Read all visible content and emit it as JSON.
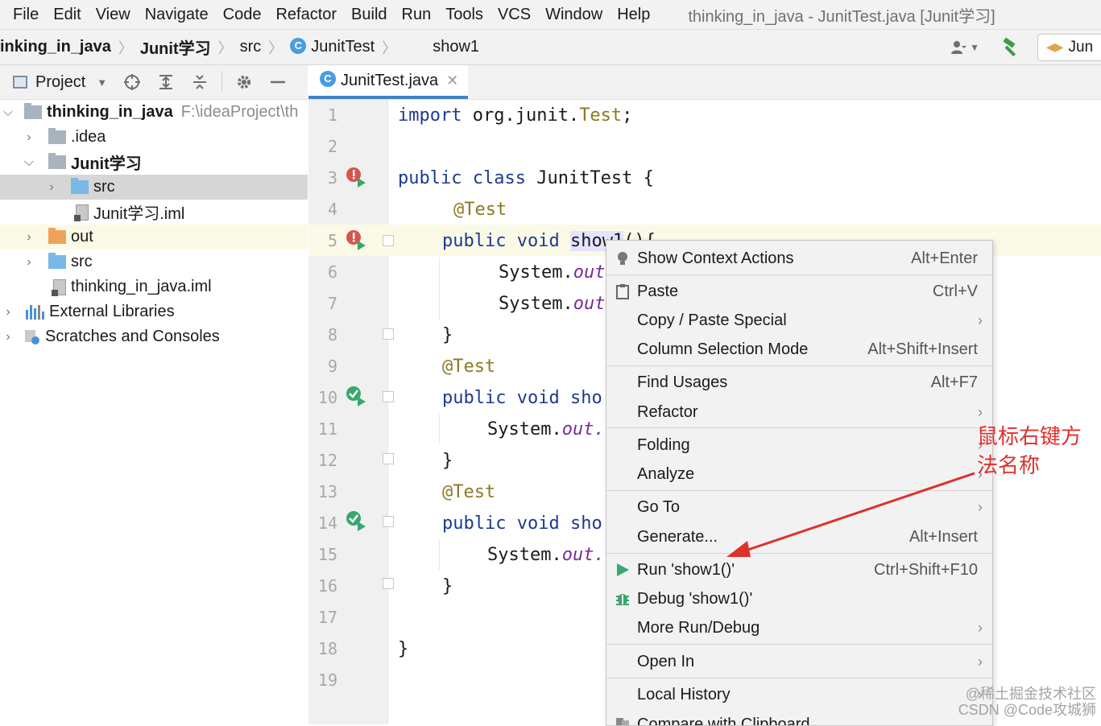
{
  "menubar": {
    "items": [
      "File",
      "Edit",
      "View",
      "Navigate",
      "Code",
      "Refactor",
      "Build",
      "Run",
      "Tools",
      "VCS",
      "Window",
      "Help"
    ],
    "window_title": "thinking_in_java - JunitTest.java [Junit学习]"
  },
  "navbar": {
    "crumbs": [
      "inking_in_java",
      "Junit学习",
      "src",
      "JunitTest",
      "show1"
    ],
    "run_config": "Jun"
  },
  "project_panel": {
    "title": "Project",
    "tree": [
      {
        "label": "thinking_in_java",
        "path": "F:\\ideaProject\\th"
      },
      {
        "label": ".idea"
      },
      {
        "label": "Junit学习"
      },
      {
        "label": "src"
      },
      {
        "label": "Junit学习.iml"
      },
      {
        "label": "out"
      },
      {
        "label": "src"
      },
      {
        "label": "thinking_in_java.iml"
      },
      {
        "label": "External Libraries"
      },
      {
        "label": "Scratches and Consoles"
      }
    ]
  },
  "editor": {
    "tab_label": "JunitTest.java",
    "tab_icon_letter": "C",
    "line_numbers": [
      "1",
      "2",
      "3",
      "4",
      "5",
      "6",
      "7",
      "8",
      "9",
      "10",
      "11",
      "12",
      "13",
      "14",
      "15",
      "16",
      "17",
      "18",
      "19"
    ],
    "code": {
      "l1_kw": "import",
      "l1_pkg": " org.junit.",
      "l1_cls": "Test",
      "l1_end": ";",
      "l3_kw": "public class",
      "l3_rest": " JunitTest {",
      "anno": "@Test",
      "pv": "public void",
      "m1": "show1",
      "m1_end": "(){",
      "m_cut": "sho",
      "sys": "System.",
      "out_cut": "out",
      "out_dot": "out.",
      "brace_close": "}"
    }
  },
  "context_menu": {
    "items": [
      {
        "label": "Show Context Actions",
        "shortcut": "Alt+Enter"
      },
      {
        "label": "Paste",
        "shortcut": "Ctrl+V"
      },
      {
        "label": "Copy / Paste Special",
        "shortcut": ""
      },
      {
        "label": "Column Selection Mode",
        "shortcut": "Alt+Shift+Insert"
      },
      {
        "label": "Find Usages",
        "shortcut": "Alt+F7"
      },
      {
        "label": "Refactor",
        "shortcut": ""
      },
      {
        "label": "Folding",
        "shortcut": ""
      },
      {
        "label": "Analyze",
        "shortcut": ""
      },
      {
        "label": "Go To",
        "shortcut": ""
      },
      {
        "label": "Generate...",
        "shortcut": "Alt+Insert"
      },
      {
        "label": "Run 'show1()'",
        "shortcut": "Ctrl+Shift+F10"
      },
      {
        "label": "Debug 'show1()'",
        "shortcut": ""
      },
      {
        "label": "More Run/Debug",
        "shortcut": ""
      },
      {
        "label": "Open In",
        "shortcut": ""
      },
      {
        "label": "Local History",
        "shortcut": ""
      },
      {
        "label": "Compare with Clipboard",
        "shortcut": ""
      }
    ]
  },
  "annotation": {
    "line1": "鼠标右键方",
    "line2": "法名称",
    "color": "#e0302b"
  },
  "watermark": {
    "line1": "@稀土掘金技术社区",
    "line2": "CSDN @Code攻城狮"
  },
  "colors": {
    "keyword": "#1d3a91",
    "annotation_code": "#8c7a22",
    "field": "#7a2a9a",
    "run_green": "#3aa76d",
    "error_red": "#d9534f"
  }
}
